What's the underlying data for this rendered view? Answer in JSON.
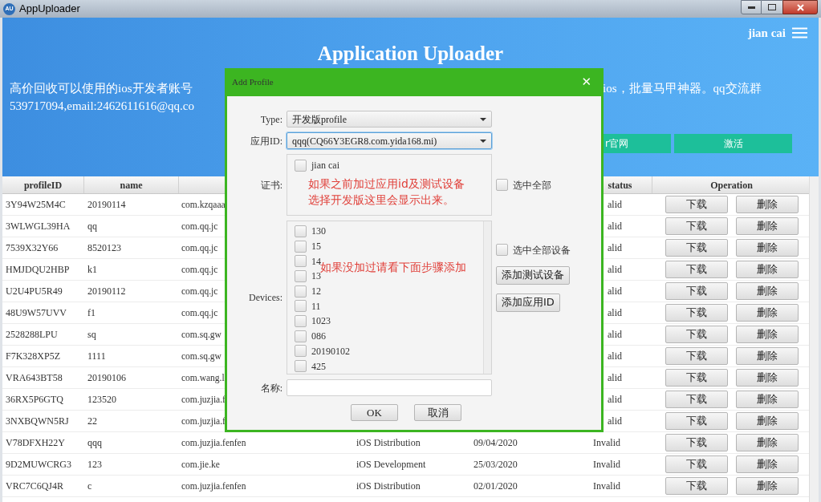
{
  "window": {
    "title": "AppUploader",
    "app_icon": "AU"
  },
  "header": {
    "title": "Application Uploader",
    "user": "jian cai",
    "notice_left": [
      "高价回收可以使用的ios开发者账号",
      "539717094,email:2462611616@qq.co"
    ],
    "notice_right": "ios，批量马甲神器。qq交流群",
    "buttons": [
      "r官网",
      "激活"
    ]
  },
  "table": {
    "columns": [
      {
        "label": "profileID",
        "kind": "id"
      },
      {
        "label": "name",
        "kind": "name"
      },
      {
        "label": "status",
        "kind": "status"
      },
      {
        "label": "Operation",
        "kind": "operation"
      }
    ],
    "rows": [
      {
        "profileID": "3Y94W25M4C",
        "name": "20190114",
        "bundle": "com.kzqaaa",
        "status": "alid",
        "actions": [
          "下载",
          "删除"
        ]
      },
      {
        "profileID": "3WLWGL39HA",
        "name": "qq",
        "bundle": "com.qq.jc",
        "status": "alid",
        "actions": [
          "下载",
          "删除"
        ]
      },
      {
        "profileID": "7539X32Y66",
        "name": "8520123",
        "bundle": "com.qq.jc",
        "status": "alid",
        "actions": [
          "下载",
          "删除"
        ]
      },
      {
        "profileID": "HMJDQU2HBP",
        "name": "k1",
        "bundle": "com.qq.jc",
        "status": "alid",
        "actions": [
          "下载",
          "删除"
        ]
      },
      {
        "profileID": "U2U4PU5R49",
        "name": "20190112",
        "bundle": "com.qq.jc",
        "status": "alid",
        "actions": [
          "下载",
          "删除"
        ]
      },
      {
        "profileID": "48U9W57UVV",
        "name": "f1",
        "bundle": "com.qq.jc",
        "status": "alid",
        "actions": [
          "下载",
          "删除"
        ]
      },
      {
        "profileID": "2528288LPU",
        "name": "sq",
        "bundle": "com.sq.gw",
        "status": "alid",
        "actions": [
          "下载",
          "删除"
        ]
      },
      {
        "profileID": "F7K328XP5Z",
        "name": "1111",
        "bundle": "com.sq.gw",
        "status": "alid",
        "actions": [
          "下载",
          "删除"
        ]
      },
      {
        "profileID": "VRA643BT58",
        "name": "20190106",
        "bundle": "com.wang.l",
        "status": "alid",
        "actions": [
          "下载",
          "删除"
        ]
      },
      {
        "profileID": "36RX5P6GTQ",
        "name": "123520",
        "bundle": "com.juzjia.f",
        "status": "alid",
        "actions": [
          "下载",
          "删除"
        ]
      },
      {
        "profileID": "3NXBQWN5RJ",
        "name": "22",
        "bundle": "com.juzjia.f",
        "status": "alid",
        "actions": [
          "下载",
          "删除"
        ]
      },
      {
        "profileID": "V78DFXH22Y",
        "name": "qqq",
        "bundle": "com.juzjia.fenfen",
        "type": "iOS Distribution",
        "date": "09/04/2020",
        "status": "Invalid",
        "actions": [
          "下载",
          "删除"
        ]
      },
      {
        "profileID": "9D2MUWCRG3",
        "name": "123",
        "bundle": "com.jie.ke",
        "type": "iOS Development",
        "date": "25/03/2020",
        "status": "Invalid",
        "actions": [
          "下载",
          "删除"
        ]
      },
      {
        "profileID": "VRC7C6QJ4R",
        "name": "c",
        "bundle": "com.juzjia.fenfen",
        "type": "iOS Distribution",
        "date": "02/01/2020",
        "status": "Invalid",
        "actions": [
          "下载",
          "删除"
        ]
      }
    ]
  },
  "dialog": {
    "title": "Add Profile",
    "close": "✕",
    "type": {
      "label": "Type:",
      "value": "开发版profile"
    },
    "app_id": {
      "label": "应用ID:",
      "value": "qqq(CQ66Y3EGR8.com.yida168.mi)"
    },
    "certificates": {
      "label": "证书:",
      "items": [
        {
          "label": "jian cai",
          "checked": false
        }
      ],
      "note": [
        "如果之前加过应用id及测试设备",
        "选择开发版这里会显示出来。"
      ],
      "select_all": {
        "label": "选中全部",
        "checked": false
      }
    },
    "devices": {
      "label": "Devices:",
      "items": [
        {
          "label": "130",
          "checked": false
        },
        {
          "label": "15",
          "checked": false
        },
        {
          "label": "14",
          "checked": false
        },
        {
          "label": "13",
          "checked": false
        },
        {
          "label": "12",
          "checked": false
        },
        {
          "label": "11",
          "checked": false
        },
        {
          "label": "1023",
          "checked": false
        },
        {
          "label": "086",
          "checked": false
        },
        {
          "label": "20190102",
          "checked": false
        },
        {
          "label": "425",
          "checked": false
        }
      ],
      "note": "如果没加过请看下面步骤添加",
      "select_all": {
        "label": "选中全部设备",
        "checked": false
      },
      "buttons": [
        "添加测试设备",
        "添加应用ID"
      ]
    },
    "name": {
      "label": "名称:"
    },
    "buttons": [
      "OK",
      "取消"
    ]
  }
}
